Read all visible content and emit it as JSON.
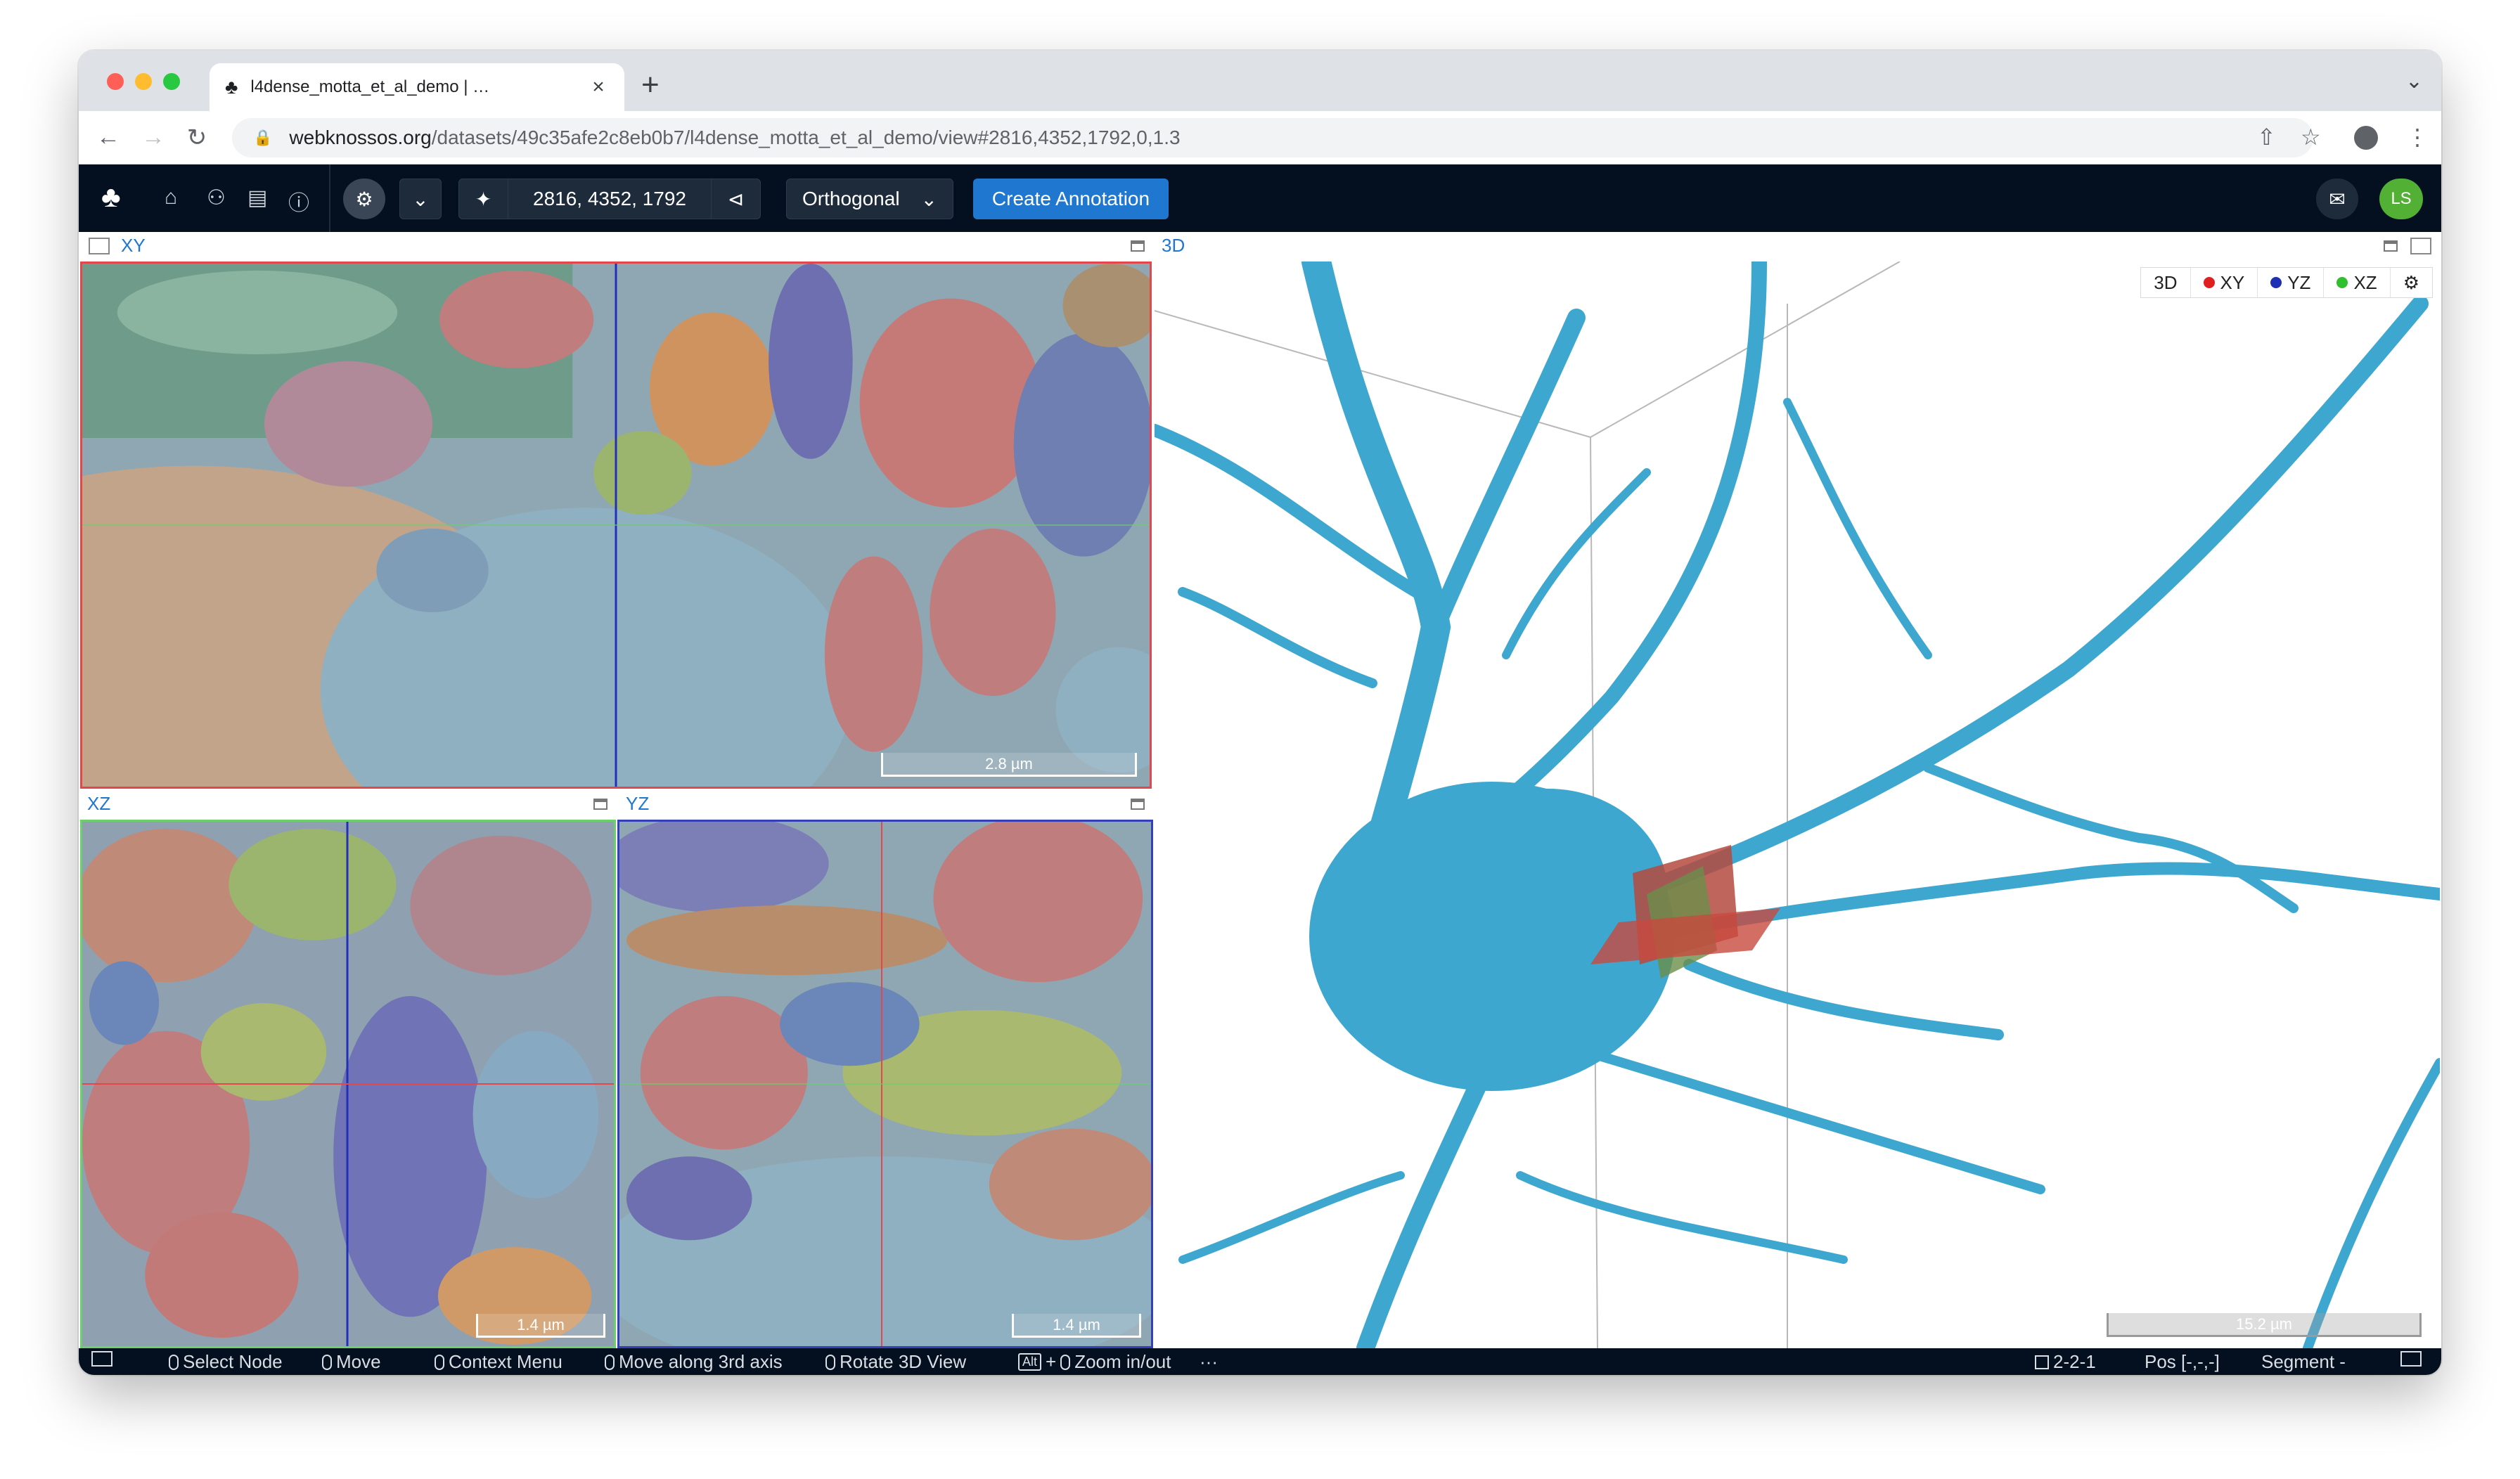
{
  "browser": {
    "tab_title": "l4dense_motta_et_al_demo | …",
    "url_host": "webknossos.org",
    "url_path": "/datasets/49c35afe2c8eb0b7/l4dense_motta_et_al_demo/view#2816,4352,1792,0,1.3"
  },
  "toolbar": {
    "position": "2816, 4352, 1792",
    "view_mode": "Orthogonal",
    "create_annotation": "Create Annotation",
    "avatar_initials": "LS"
  },
  "viewports": {
    "xy": {
      "label": "XY",
      "scale": "2.8 µm"
    },
    "xz": {
      "label": "XZ",
      "scale": "1.4 µm"
    },
    "yz": {
      "label": "YZ",
      "scale": "1.4 µm"
    },
    "td": {
      "label": "3D",
      "scale": "15.2 µm"
    }
  },
  "legend": {
    "items": [
      {
        "label": "3D",
        "color": ""
      },
      {
        "label": "XY",
        "color": "#e01f1f"
      },
      {
        "label": "YZ",
        "color": "#1f2fb4"
      },
      {
        "label": "XZ",
        "color": "#2fbf2f"
      }
    ]
  },
  "status": {
    "select_node": "Select Node",
    "move": "Move",
    "context_menu": "Context Menu",
    "move_axis": "Move along 3rd axis",
    "rotate": "Rotate 3D View",
    "alt_key": "Alt",
    "zoom": "Zoom in/out",
    "more": "···",
    "mag": "2-2-1",
    "pos": "Pos [-,-,-]",
    "segment": "Segment -"
  },
  "colors": {
    "neuron": "#3ea7cf",
    "xy_border": "#e0484d",
    "xz_border": "#6ccf6c",
    "yz_border": "#3440b8",
    "accent": "#1f77d0"
  }
}
